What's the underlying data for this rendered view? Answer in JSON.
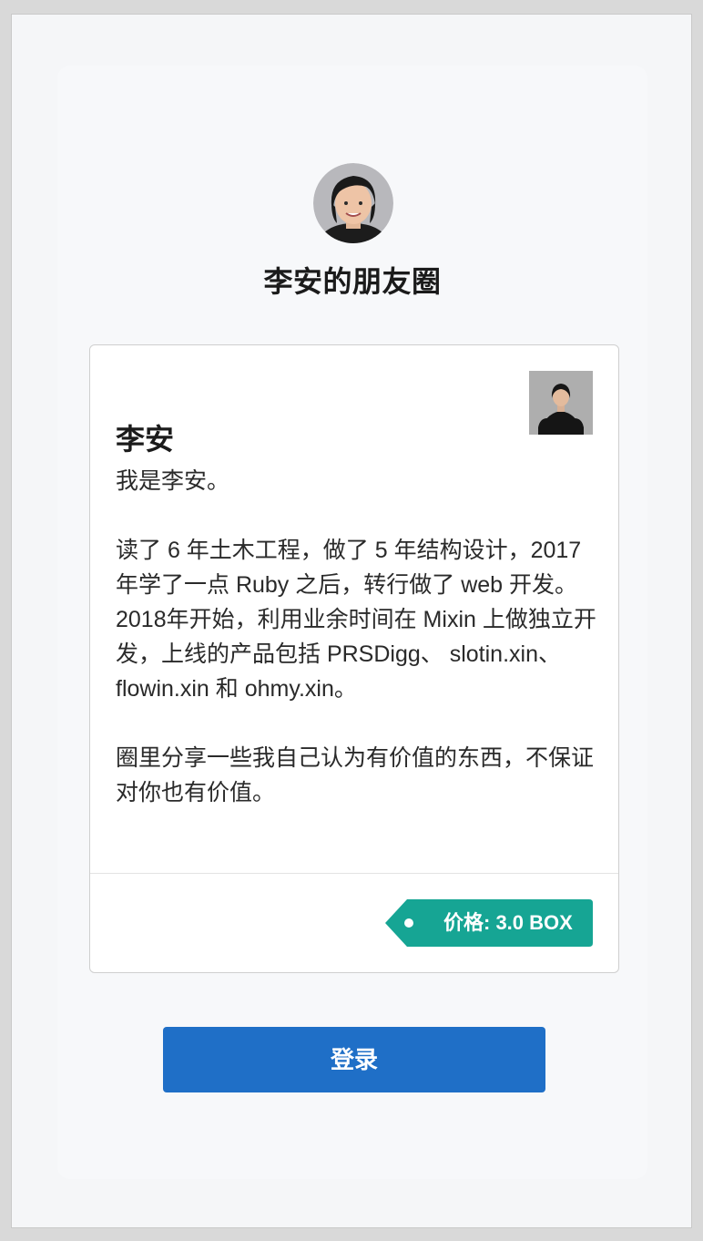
{
  "header": {
    "title": "李安的朋友圈"
  },
  "card": {
    "name": "李安",
    "paragraphs": [
      "我是李安。",
      "读了 6 年土木工程，做了 5 年结构设计，2017 年学了一点 Ruby 之后，转行做了 web 开发。2018年开始，利用业余时间在 Mixin 上做独立开发，上线的产品包括 PRSDigg、 slotin.xin、 flowin.xin 和 ohmy.xin。",
      "圈里分享一些我自己认为有价值的东西，不保证对你也有价值。"
    ],
    "price_label": "价格: 3.0 BOX"
  },
  "login": {
    "label": "登录"
  },
  "colors": {
    "accent": "#1f6fc7",
    "price_tag": "#16a594",
    "background": "#f5f6f8",
    "card": "#ffffff"
  },
  "icons": {
    "header_avatar": "avatar-portrait",
    "card_thumb": "profile-photo",
    "price_dot": "tag-dot-icon"
  }
}
